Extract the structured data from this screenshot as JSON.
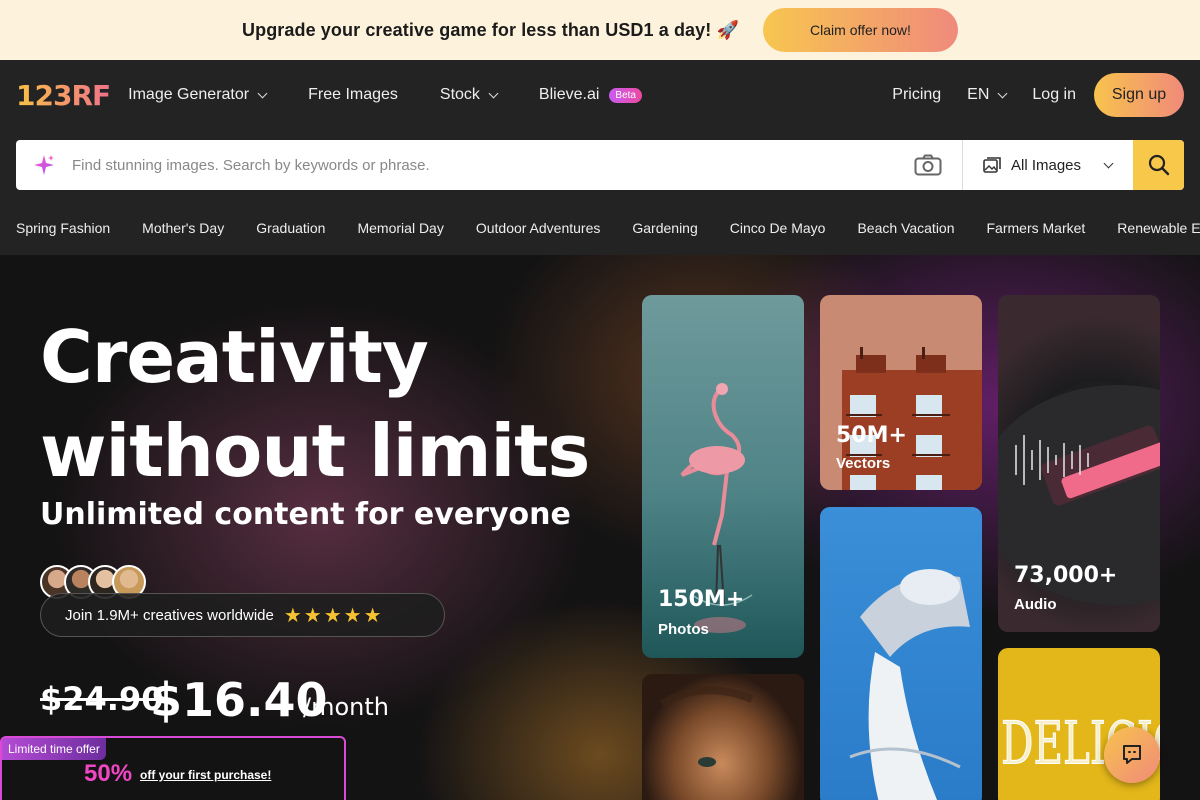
{
  "promo": {
    "text": "Upgrade your creative game for less than USD1 a day! 🚀",
    "button": "Claim offer now!"
  },
  "nav": {
    "logo": "123RF",
    "items": [
      {
        "label": "Image Generator",
        "dropdown": true
      },
      {
        "label": "Free Images",
        "dropdown": false
      },
      {
        "label": "Stock",
        "dropdown": true
      },
      {
        "label": "Blieve.ai",
        "badge": "Beta"
      }
    ],
    "pricing": "Pricing",
    "language": "EN",
    "login": "Log in",
    "signup": "Sign up"
  },
  "search": {
    "placeholder": "Find stunning images. Search by keywords or phrase.",
    "type": "All Images"
  },
  "tags": [
    "Spring Fashion",
    "Mother's Day",
    "Graduation",
    "Memorial Day",
    "Outdoor Adventures",
    "Gardening",
    "Cinco De Mayo",
    "Beach Vacation",
    "Farmers Market",
    "Renewable Energy"
  ],
  "hero": {
    "headline_line1": "Creativity",
    "headline_line2": "without limits",
    "subhead": "Unlimited content for everyone",
    "join_text": "Join 1.9M+ creatives worldwide",
    "stars": "★★★★★",
    "old_price": "$24.90",
    "new_price": "$16.40",
    "per": "/month",
    "offer_tag": "Limited time offer",
    "offer_pct": "50%",
    "offer_text": "off your first purchase!"
  },
  "cards": {
    "photos": {
      "num": "150M+",
      "label": "Photos"
    },
    "vectors": {
      "num": "50M+",
      "label": "Vectors"
    },
    "audio": {
      "num": "73,000+",
      "label": "Audio"
    }
  },
  "colors": {
    "accent": "#f8c84a",
    "brand_gradient_start": "#f8c146",
    "brand_gradient_end": "#f0728a",
    "offer_pink": "#f146c4"
  }
}
